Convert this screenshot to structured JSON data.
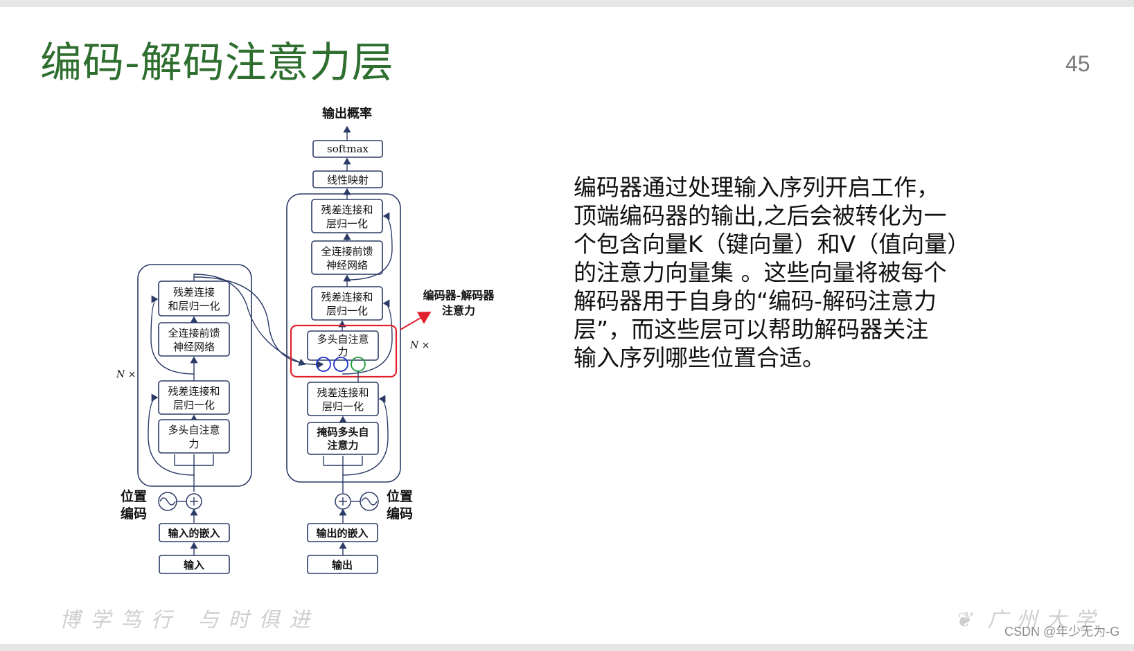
{
  "slide": {
    "title": "编码-解码注意力层",
    "page_number": "45",
    "body_lines": [
      "编码器通过处理输入序列开启工作，",
      "顶端编码器的输出,之后会被转化为一",
      "个包含向量K（键向量）和V（值向量）",
      "的注意力向量集 。这些向量将被每个",
      "解码器用于自身的“编码-解码注意力",
      "层”，而这些层可以帮助解码器关注",
      "输入序列哪些位置合适。"
    ],
    "footer_motto": "博学笃行 与时俱进",
    "footer_university": "广州大学",
    "watermark": "CSDN @年少无为-G"
  },
  "diagram": {
    "output_prob": "输出概率",
    "softmax": "softmax",
    "linear": "线性映射",
    "encoder": {
      "repeat": "N ×",
      "add_norm_top": [
        "残差连接",
        "和层归一化"
      ],
      "ffn": [
        "全连接前馈",
        "神经网络"
      ],
      "add_norm_bottom": [
        "残差连接和",
        "层归一化"
      ],
      "mha": [
        "多头自注意",
        "力"
      ],
      "pos_enc": [
        "位置",
        "编码"
      ],
      "input_embed": "输入的嵌入",
      "input": "输入"
    },
    "decoder": {
      "repeat": "N ×",
      "add_norm_3": [
        "残差连接和",
        "层归一化"
      ],
      "ffn": [
        "全连接前馈",
        "神经网络"
      ],
      "add_norm_2": [
        "残差连接和",
        "层归一化"
      ],
      "enc_dec_attn": [
        "多头自注意",
        "力"
      ],
      "add_norm_1": [
        "残差连接和",
        "层归一化"
      ],
      "masked_mha": [
        "掩码多头自",
        "注意力"
      ],
      "pos_enc": [
        "位置",
        "编码"
      ],
      "output_embed": "输出的嵌入",
      "output": "输出"
    },
    "callout": [
      "编码器-解码器",
      "注意力"
    ],
    "colors": {
      "box_stroke": "#2b3a66",
      "highlight": "#e0202a",
      "kv_circle": "#1f2fc8",
      "q_circle": "#1f9a3a",
      "title_green": "#2e6e2f"
    }
  }
}
